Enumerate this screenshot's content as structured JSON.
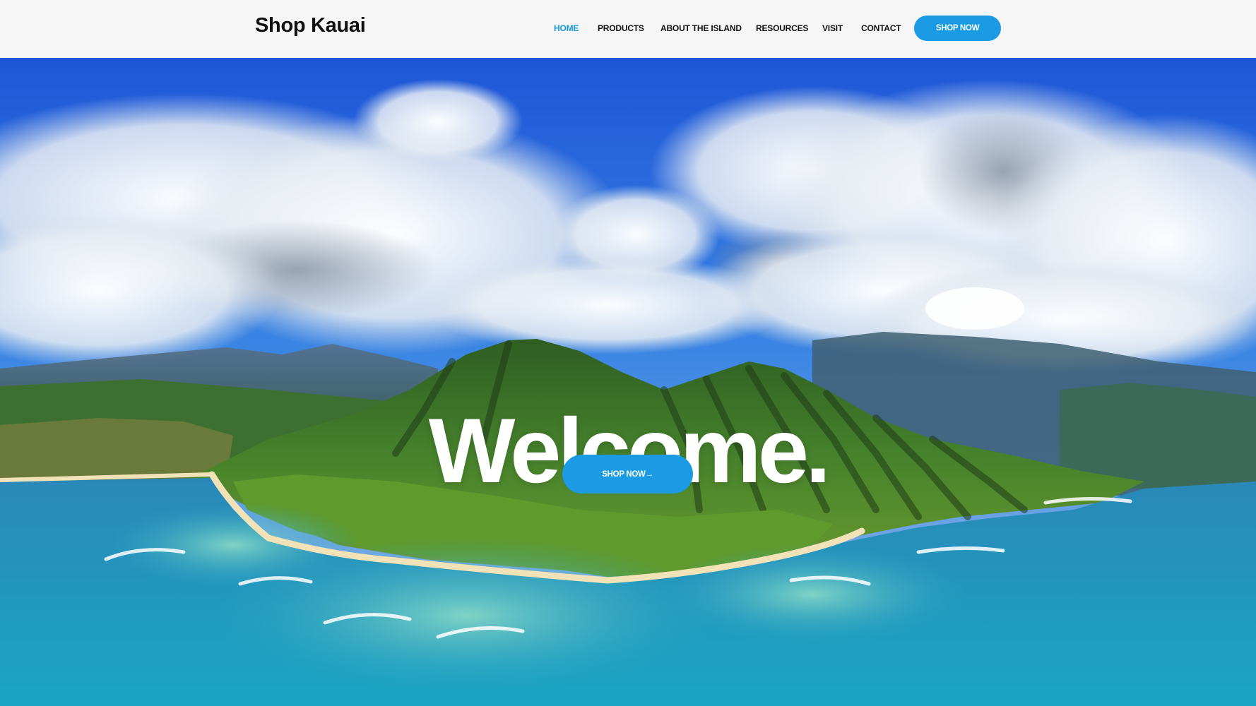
{
  "header": {
    "logo": "Shop Kauai",
    "nav": [
      {
        "label": "HOME",
        "active": true
      },
      {
        "label": "PRODUCTS",
        "active": false
      },
      {
        "label": "ABOUT THE ISLAND",
        "active": false
      },
      {
        "label": "RESOURCES",
        "active": false
      },
      {
        "label": "VISIT",
        "active": false
      },
      {
        "label": "CONTACT",
        "active": false
      }
    ],
    "cta_label": "SHOP NOW"
  },
  "hero": {
    "title": "Welcome.",
    "cta_label": "SHOP NOW→",
    "background": "aerial-island-photo"
  },
  "colors": {
    "accent": "#1a9be3",
    "active_nav": "#1897dd",
    "header_bg": "#f6f6f6",
    "text": "#111111"
  }
}
